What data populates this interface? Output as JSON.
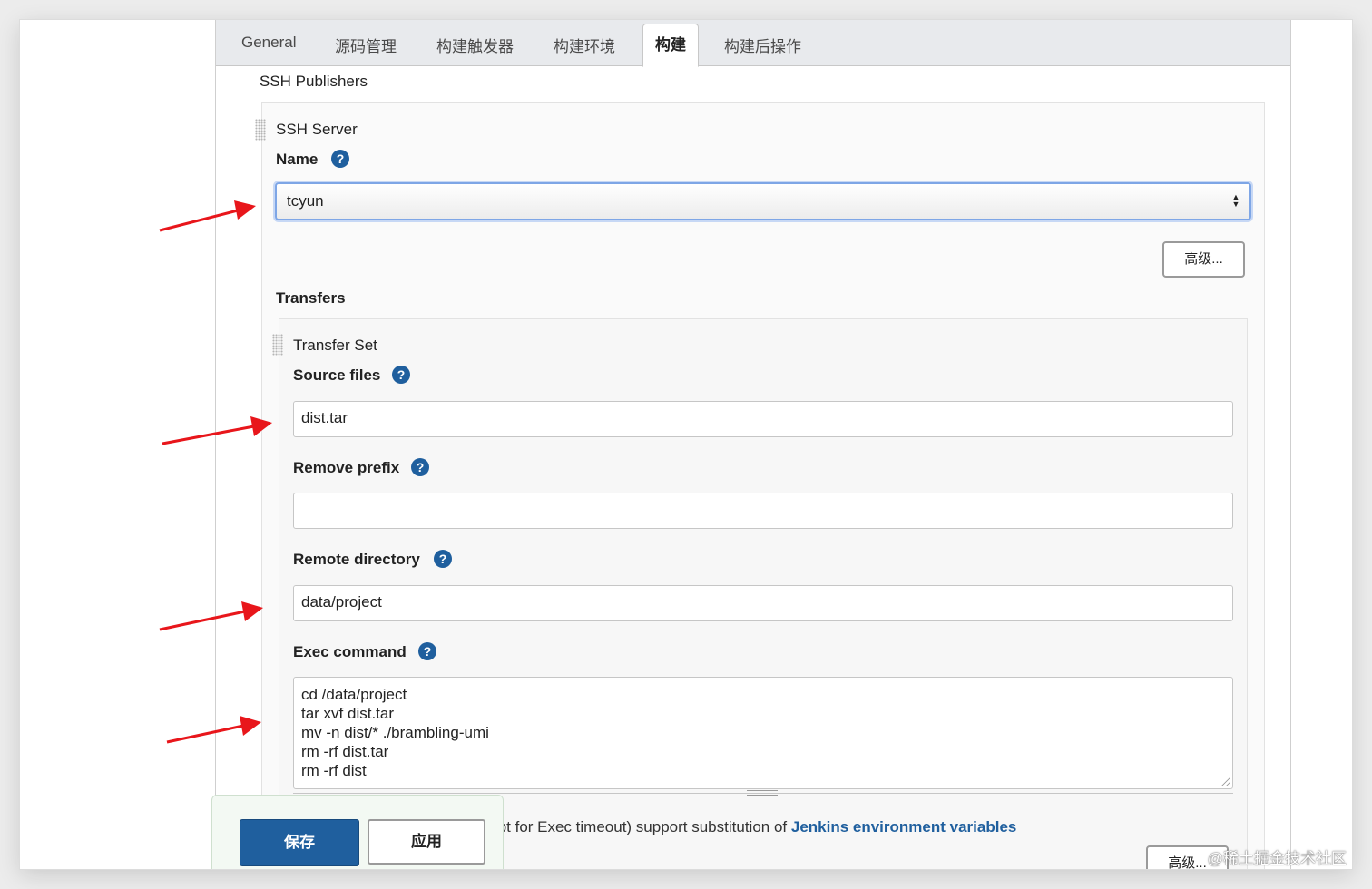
{
  "tabs": [
    {
      "label": "General"
    },
    {
      "label": "源码管理"
    },
    {
      "label": "构建触发器"
    },
    {
      "label": "构建环境"
    },
    {
      "label": "构建"
    },
    {
      "label": "构建后操作"
    }
  ],
  "active_tab": "构建",
  "ssh_publishers": {
    "title": "SSH Publishers",
    "server_title": "SSH Server",
    "name_label": "Name",
    "name_value": "tcyun",
    "advanced_label": "高级...",
    "transfers_title": "Transfers",
    "transfer_set": {
      "title": "Transfer Set",
      "source_files_label": "Source files",
      "source_files_value": "dist.tar",
      "remove_prefix_label": "Remove prefix",
      "remove_prefix_value": "",
      "remote_directory_label": "Remote directory",
      "remote_directory_value": "data/project",
      "exec_command_label": "Exec command",
      "exec_command_lines": [
        "cd /data/project",
        "tar xvf dist.tar",
        "mv -n dist/* ./brambling-umi",
        "rm -rf dist.tar",
        "rm -rf dist"
      ],
      "note_prefix": "t",
      "note_text": "cept for Exec timeout) support substitution of ",
      "note_link": "Jenkins environment variables",
      "advanced_label_bottom": "高级..."
    }
  },
  "help_glyph": "?",
  "footer": {
    "save_label": "保存",
    "apply_label": "应用"
  },
  "watermark": "@稀土掘金技术社区",
  "colors": {
    "primary": "#1f5f9e",
    "arrow": "#e8161b",
    "focus": "#7ea6e6"
  }
}
